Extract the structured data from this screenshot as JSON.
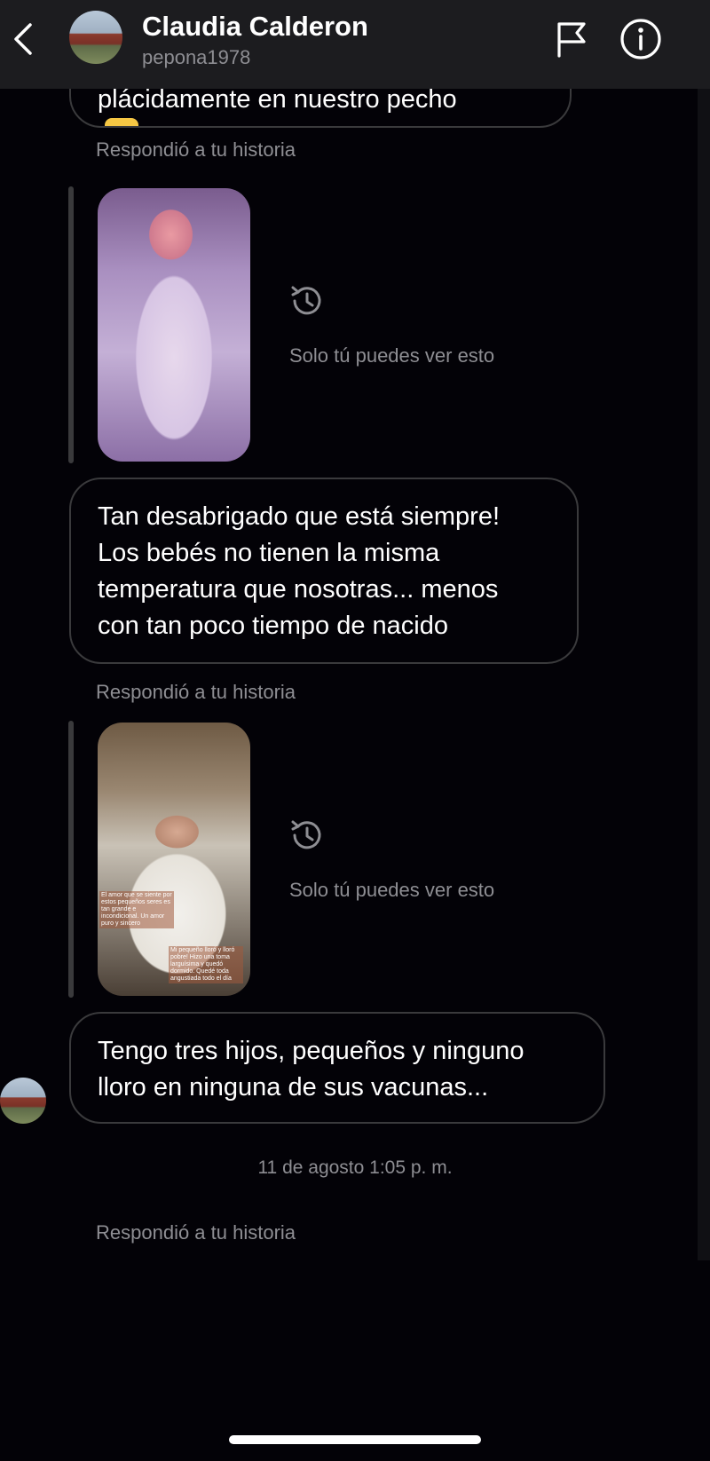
{
  "header": {
    "name": "Claudia Calderon",
    "username": "pepona1978"
  },
  "icons": {
    "back": "chevron-left-icon",
    "flag": "flag-icon",
    "info": "info-icon",
    "history": "history-icon"
  },
  "messages": {
    "top_partial": "plácidamente en nuestro pecho",
    "story_reply_label": "Respondió a tu historia",
    "only_you_label": "Solo tú puedes ver esto",
    "message_1_lines": [
      "Tan desabrigado que está siempre!",
      "Los bebés no tienen la misma",
      "temperatura que nosotras... menos",
      "con tan poco tiempo de nacido"
    ],
    "message_2_lines": [
      "Tengo tres hijos, pequeños y ninguno",
      "lloro en ninguna de sus vacunas..."
    ],
    "timestamp": "11 de agosto 1:05 p. m."
  },
  "story_captions": {
    "caption_1": "El amor que se siente por estos pequeños seres es tan grande e incondicional. Un amor puro y sincero",
    "caption_2": "Mi pequeño lloró y lloró pobre! Hizo una toma larguísima y quedó dormido. Quedé toda angustiada todo el día"
  },
  "colors": {
    "background": "#030207",
    "header_bg": "#1c1c1f",
    "secondary_text": "#8e8e93",
    "bubble_border": "#3a3a3c"
  }
}
